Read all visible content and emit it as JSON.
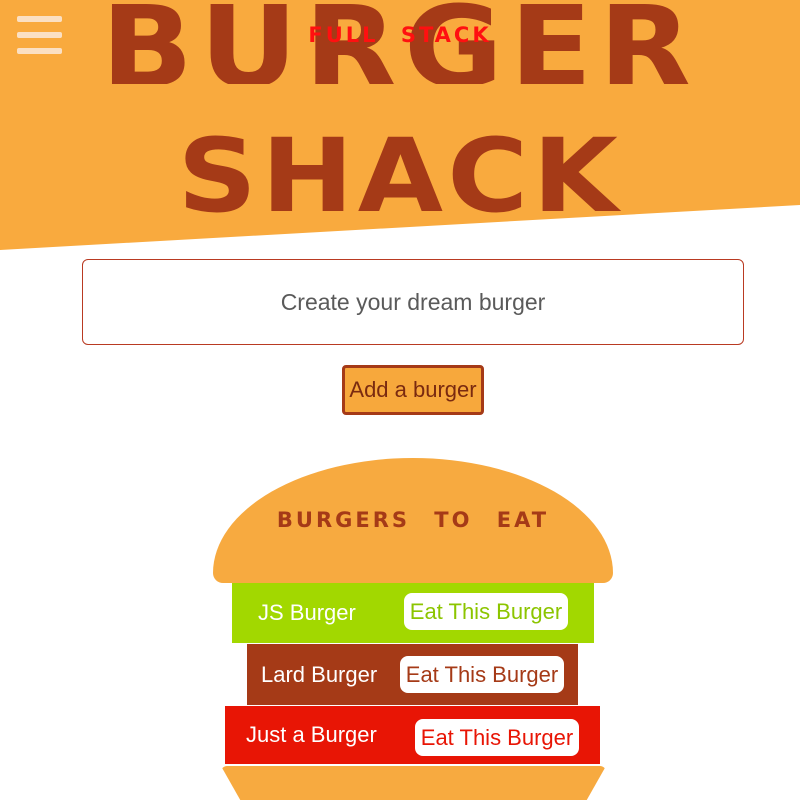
{
  "header": {
    "menu_icon": "hamburger-menu-icon",
    "title_line1": "BURGER",
    "title_line2": "SHACK",
    "subtitle": "FULL STACK"
  },
  "form": {
    "input_placeholder": "Create your dream burger",
    "input_value": "",
    "add_button_label": "Add a burger"
  },
  "burger_list": {
    "heading": "BURGERS TO EAT",
    "items": [
      {
        "name": "JS Burger",
        "button_label": "Eat This Burger",
        "color": "#a2d800"
      },
      {
        "name": "Lard Burger",
        "button_label": "Eat This Burger",
        "color": "#a53a17"
      },
      {
        "name": "Just a Burger",
        "button_label": "Eat This Burger",
        "color": "#e81505"
      }
    ]
  },
  "colors": {
    "bun": "#f7aa40",
    "brand_brown": "#a53a17",
    "subtitle_red": "#ff1010",
    "menu_icon": "#fbe0c3"
  }
}
